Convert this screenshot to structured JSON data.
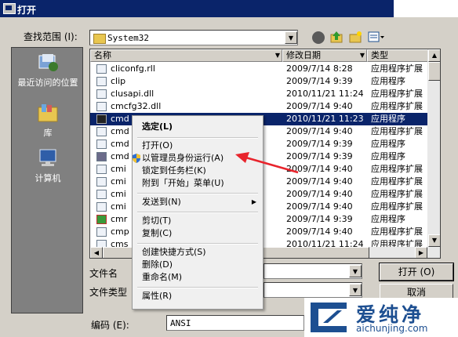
{
  "window": {
    "title": "打开"
  },
  "toolbar": {
    "look_in_label": "查找范围 (I):",
    "look_in_value": "System32"
  },
  "places": [
    {
      "label": "最近访问的位置",
      "icon": "recent-places-icon"
    },
    {
      "label": "库",
      "icon": "library-icon"
    },
    {
      "label": "计算机",
      "icon": "computer-icon"
    }
  ],
  "columns": {
    "name": "名称",
    "date": "修改日期",
    "type": "类型"
  },
  "files": [
    {
      "name": "cliconfg.rll",
      "date": "2009/7/14 8:28",
      "type": "应用程序扩展"
    },
    {
      "name": "clip",
      "date": "2009/7/14 9:39",
      "type": "应用程序"
    },
    {
      "name": "clusapi.dll",
      "date": "2010/11/21 11:24",
      "type": "应用程序扩展"
    },
    {
      "name": "cmcfg32.dll",
      "date": "2009/7/14 9:40",
      "type": "应用程序扩展"
    },
    {
      "name": "cmd",
      "date": "2010/11/21 11:23",
      "type": "应用程序"
    },
    {
      "name": "cmd",
      "date": "2009/7/14 9:40",
      "type": "应用程序扩展"
    },
    {
      "name": "cmd",
      "date": "2009/7/14 9:39",
      "type": "应用程序"
    },
    {
      "name": "cmd",
      "date": "2009/7/14 9:39",
      "type": "应用程序"
    },
    {
      "name": "cmi",
      "date": "2009/7/14 9:40",
      "type": "应用程序扩展"
    },
    {
      "name": "cmi",
      "date": "2009/7/14 9:40",
      "type": "应用程序扩展"
    },
    {
      "name": "cmi",
      "date": "2009/7/14 9:40",
      "type": "应用程序扩展"
    },
    {
      "name": "cmi",
      "date": "2009/7/14 9:40",
      "type": "应用程序扩展"
    },
    {
      "name": "cmr",
      "date": "2009/7/14 9:39",
      "type": "应用程序"
    },
    {
      "name": "cmp",
      "date": "2009/7/14 9:40",
      "type": "应用程序扩展"
    },
    {
      "name": "cms",
      "date": "2010/11/21 11:24",
      "type": "应用程序扩展"
    }
  ],
  "context_menu": {
    "select": "选定(L)",
    "open": "打开(O)",
    "run_as_admin": "以管理员身份运行(A)",
    "pin_taskbar": "锁定到任务栏(K)",
    "pin_start": "附到「开始」菜单(U)",
    "send_to": "发送到(N)",
    "cut": "剪切(T)",
    "copy": "复制(C)",
    "create_shortcut": "创建快捷方式(S)",
    "delete": "删除(D)",
    "rename": "重命名(M)",
    "properties": "属性(R)"
  },
  "bottom": {
    "filename_label": "文件名",
    "filetype_label": "文件类型",
    "open_button": "打开 (O)",
    "cancel_button": "取消",
    "encoding_label": "编码 (E):",
    "encoding_value": "ANSI"
  },
  "watermark": {
    "text": "爱纯净",
    "url": "aichunjing.com"
  },
  "colors": {
    "title": "#0a246a",
    "selection": "#0a246a",
    "arrow": "#e8242c",
    "watermark": "#1d4f91"
  }
}
